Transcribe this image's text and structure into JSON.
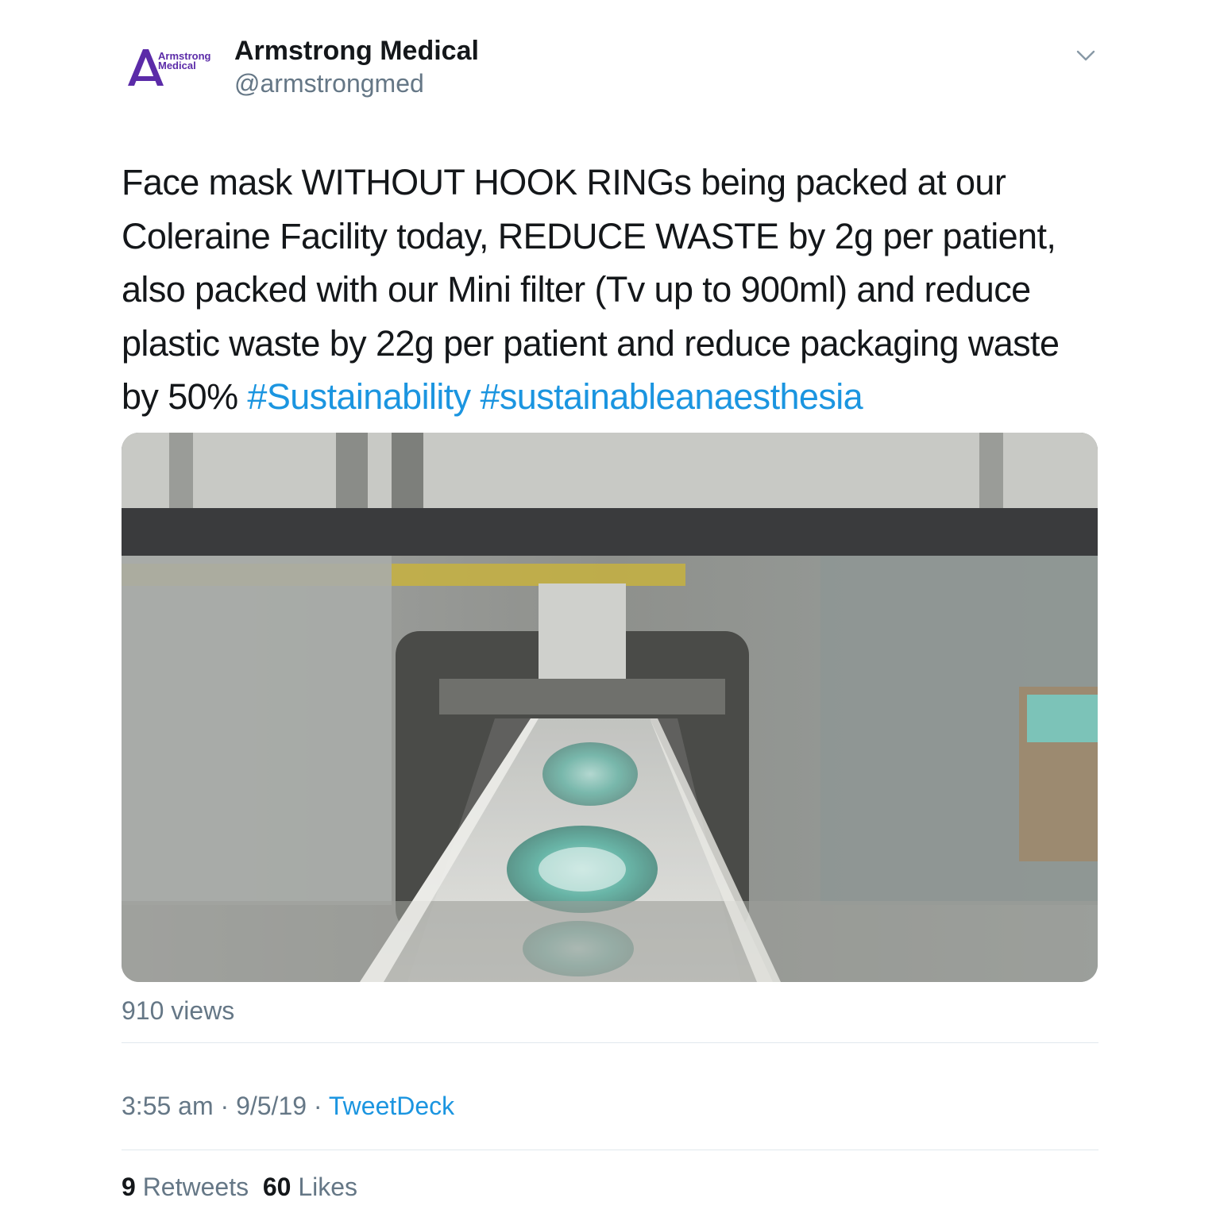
{
  "account": {
    "display_name": "Armstrong Medical",
    "handle": "@armstrongmed",
    "avatar_logo_text": "Armstrong\nMedical",
    "avatar_icon": "armstrong-medical-logo",
    "menu_icon": "chevron-down-icon"
  },
  "tweet": {
    "text": "Face mask WITHOUT HOOK RINGs being packed at our Coleraine Facility today, REDUCE WASTE by 2g per patient, also packed with our Mini filter (Tv up to 900ml) and reduce plastic waste by 22g per patient and reduce packaging waste by 50% ",
    "hashtags": [
      "#Sustainability",
      "#sustainableanaesthesia"
    ],
    "views": "910 views",
    "time": "3:55 am",
    "separator": "·",
    "date": "9/5/19",
    "source": "TweetDeck"
  },
  "stats": {
    "retweets_count": "9",
    "retweets_label": "Retweets",
    "likes_count": "60",
    "likes_label": "Likes"
  },
  "colors": {
    "link": "#1b95e0",
    "secondary_text": "#657786",
    "primary_text": "#14171a",
    "brand_purple": "#5b2ba8"
  }
}
